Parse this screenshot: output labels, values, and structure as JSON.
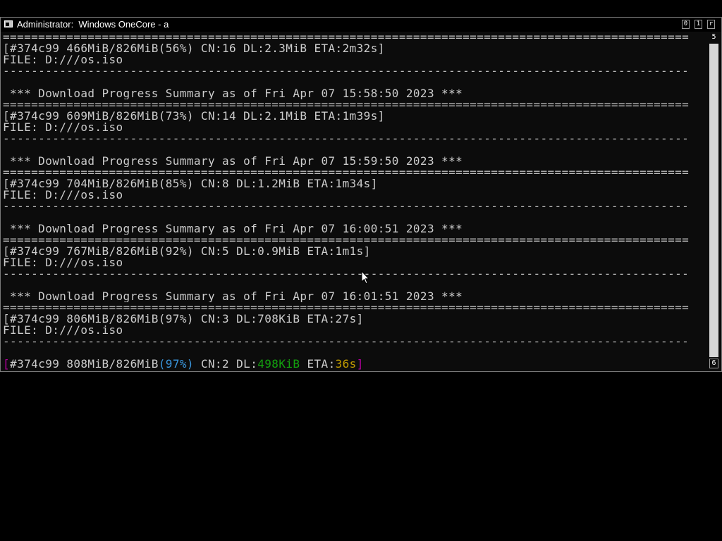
{
  "window": {
    "title": "Administrator:  Windows OneCore - a",
    "buttons": [
      "0",
      "1",
      "r"
    ]
  },
  "scrollbar": {
    "top_number": "5",
    "bottom_number": "6"
  },
  "console": {
    "separator_double": "=================================================================================================",
    "separator_single": "-------------------------------------------------------------------------------------------------",
    "lines": [
      {
        "kind": "double"
      },
      {
        "kind": "text",
        "text": "[#374c99 466MiB/826MiB(56%) CN:16 DL:2.3MiB ETA:2m32s]"
      },
      {
        "kind": "text",
        "text": "FILE: D:///os.iso"
      },
      {
        "kind": "single"
      },
      {
        "kind": "blank"
      },
      {
        "kind": "text",
        "text": " *** Download Progress Summary as of Fri Apr 07 15:58:50 2023 ***"
      },
      {
        "kind": "double"
      },
      {
        "kind": "text",
        "text": "[#374c99 609MiB/826MiB(73%) CN:14 DL:2.1MiB ETA:1m39s]"
      },
      {
        "kind": "text",
        "text": "FILE: D:///os.iso"
      },
      {
        "kind": "single"
      },
      {
        "kind": "blank"
      },
      {
        "kind": "text",
        "text": " *** Download Progress Summary as of Fri Apr 07 15:59:50 2023 ***"
      },
      {
        "kind": "double"
      },
      {
        "kind": "text",
        "text": "[#374c99 704MiB/826MiB(85%) CN:8 DL:1.2MiB ETA:1m34s]"
      },
      {
        "kind": "text",
        "text": "FILE: D:///os.iso"
      },
      {
        "kind": "single"
      },
      {
        "kind": "blank"
      },
      {
        "kind": "text",
        "text": " *** Download Progress Summary as of Fri Apr 07 16:00:51 2023 ***"
      },
      {
        "kind": "double"
      },
      {
        "kind": "text",
        "text": "[#374c99 767MiB/826MiB(92%) CN:5 DL:0.9MiB ETA:1m1s]"
      },
      {
        "kind": "text",
        "text": "FILE: D:///os.iso"
      },
      {
        "kind": "single"
      },
      {
        "kind": "blank"
      },
      {
        "kind": "text",
        "text": " *** Download Progress Summary as of Fri Apr 07 16:01:51 2023 ***"
      },
      {
        "kind": "double"
      },
      {
        "kind": "text",
        "text": "[#374c99 806MiB/826MiB(97%) CN:3 DL:708KiB ETA:27s]"
      },
      {
        "kind": "text",
        "text": "FILE: D:///os.iso"
      },
      {
        "kind": "single"
      },
      {
        "kind": "blank"
      }
    ],
    "status_line": {
      "open_bracket": "[",
      "gid": "#374c99 ",
      "progress": "808MiB/826MiB",
      "percent": "(97%)",
      "connections": " CN:2 ",
      "dl_label": "DL:",
      "dl_speed": "498KiB",
      "eta_label": " ETA:",
      "eta_value": "36s",
      "close_bracket": "]"
    }
  },
  "colors": {
    "text": "#cccccc",
    "background": "#0c0c0c",
    "bracket": "#b4009e",
    "percent": "#3a96dd",
    "speed": "#13a10e",
    "eta": "#c19c00"
  }
}
